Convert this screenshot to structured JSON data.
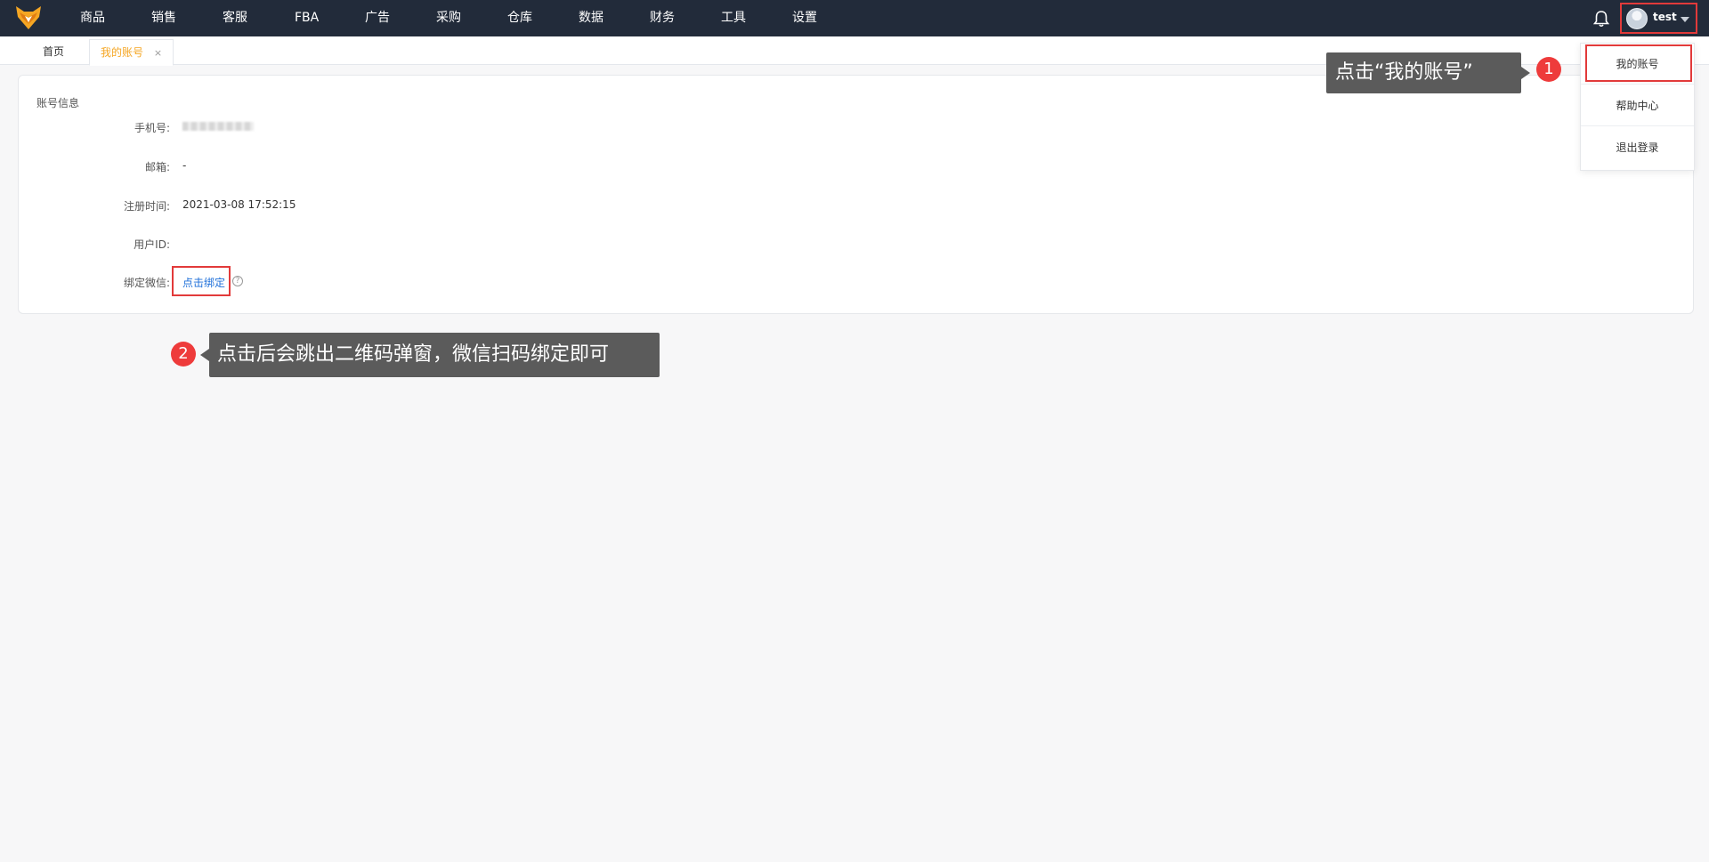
{
  "nav": {
    "items": [
      "商品",
      "销售",
      "客服",
      "FBA",
      "广告",
      "采购",
      "仓库",
      "数据",
      "财务",
      "工具",
      "设置"
    ]
  },
  "user": {
    "name": "test"
  },
  "tabs": {
    "home": "首页",
    "account": "我的账号",
    "close": "×"
  },
  "card": {
    "title": "账号信息",
    "phone_label": "手机号:",
    "email_label": "邮箱:",
    "email_value": "-",
    "register_label": "注册时间:",
    "register_value": "2021-03-08 17:52:15",
    "userid_label": "用户ID:",
    "wechat_label": "绑定微信:",
    "wechat_link": "点击绑定",
    "help": "?"
  },
  "dropdown": {
    "items": [
      "我的账号",
      "帮助中心",
      "退出登录"
    ]
  },
  "callouts": {
    "step1_text": "点击“我的账号”",
    "step1_badge": "1",
    "step2_text": "点击后会跳出二维码弹窗，微信扫码绑定即可",
    "step2_badge": "2"
  },
  "colors": {
    "topbar": "#222b3a",
    "accent_tab": "#f5a623",
    "link": "#1e6fd9",
    "highlight": "#e23a3a"
  },
  "icons": {
    "logo": "fox-logo-icon",
    "bell": "bell-icon",
    "caret": "caret-down-icon",
    "help": "question-circle-icon"
  }
}
